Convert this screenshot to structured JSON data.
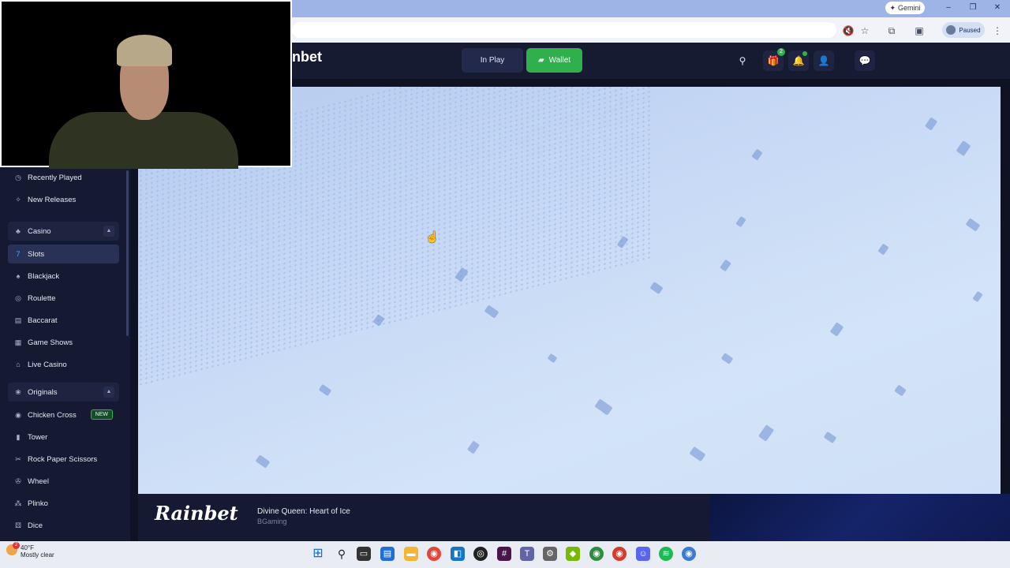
{
  "browser": {
    "gemini_label": "Gemini",
    "paused_label": "Paused",
    "window_controls": {
      "minimize": "–",
      "restore": "❐",
      "close": "✕"
    }
  },
  "header": {
    "logo_text": "nbet",
    "in_play_label": "In Play",
    "wallet_label": "Wallet",
    "gift_badge_count": "2",
    "icons": [
      "search-icon",
      "gift-icon",
      "bell-icon",
      "user-icon",
      "chat-icon"
    ]
  },
  "sidebar": {
    "items": [
      {
        "label": "Recently Played",
        "icon": "clock-icon"
      },
      {
        "label": "New Releases",
        "icon": "sparkle-icon"
      },
      {
        "label": "Casino",
        "icon": "casino-icon"
      },
      {
        "label": "Slots",
        "icon": "slots-icon"
      },
      {
        "label": "Blackjack",
        "icon": "blackjack-icon"
      },
      {
        "label": "Roulette",
        "icon": "roulette-icon"
      },
      {
        "label": "Baccarat",
        "icon": "baccarat-icon"
      },
      {
        "label": "Game Shows",
        "icon": "game-shows-icon"
      },
      {
        "label": "Live Casino",
        "icon": "live-icon"
      },
      {
        "label": "Originals",
        "icon": "originals-icon"
      },
      {
        "label": "Chicken Cross",
        "icon": "chicken-icon"
      },
      {
        "label": "Tower",
        "icon": "tower-icon"
      },
      {
        "label": "Rock Paper Scissors",
        "icon": "rps-icon"
      },
      {
        "label": "Wheel",
        "icon": "wheel-icon"
      },
      {
        "label": "Plinko",
        "icon": "plinko-icon"
      },
      {
        "label": "Dice",
        "icon": "dice-icon"
      }
    ],
    "new_badge": "NEW"
  },
  "game_footer": {
    "logo": "Rainbet",
    "title": "Divine Queen: Heart of Ice",
    "provider": "BGaming"
  },
  "taskbar": {
    "temperature": "40°F",
    "condition": "Mostly clear",
    "notification_count": "2"
  },
  "colors": {
    "accent_green": "#2fb04c",
    "sidebar_bg": "#151932",
    "header_bg": "#171b32"
  }
}
